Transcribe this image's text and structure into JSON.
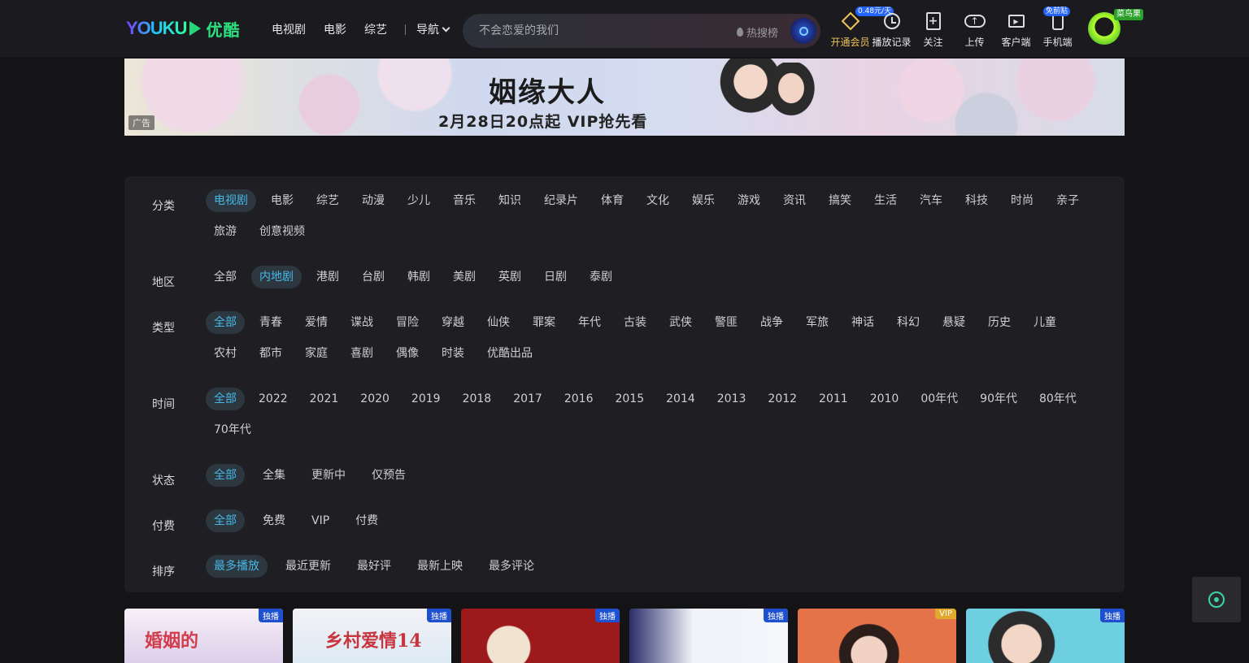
{
  "header": {
    "logo_text": "YOUKU",
    "logo_cn": "优酷",
    "nav": [
      "电视剧",
      "电影",
      "综艺"
    ],
    "guide_label": "导航",
    "search": {
      "placeholder": "不会恋爱的我们",
      "hot_label": "热搜榜"
    },
    "tools": [
      {
        "label": "开通会员",
        "icon": "diamond-icon",
        "tag": "0.48元/天"
      },
      {
        "label": "播放记录",
        "icon": "clock-icon"
      },
      {
        "label": "关注",
        "icon": "bookmark-plus-icon"
      },
      {
        "label": "上传",
        "icon": "upload-cloud-icon"
      },
      {
        "label": "客户端",
        "icon": "tv-play-icon"
      },
      {
        "label": "手机端",
        "icon": "phone-icon",
        "tag": "免前贴"
      }
    ],
    "avatar_badge": "菜鸟果"
  },
  "banner": {
    "title": "姻缘大人",
    "subtitle": "2月28日20点起 VIP抢先看",
    "ad_label": "广告"
  },
  "filters": [
    {
      "label": "分类",
      "active": 0,
      "items": [
        "电视剧",
        "电影",
        "综艺",
        "动漫",
        "少儿",
        "音乐",
        "知识",
        "纪录片",
        "体育",
        "文化",
        "娱乐",
        "游戏",
        "资讯",
        "搞笑",
        "生活",
        "汽车",
        "科技",
        "时尚",
        "亲子",
        "旅游",
        "创意视频"
      ]
    },
    {
      "label": "地区",
      "active": 1,
      "items": [
        "全部",
        "内地剧",
        "港剧",
        "台剧",
        "韩剧",
        "美剧",
        "英剧",
        "日剧",
        "泰剧"
      ]
    },
    {
      "label": "类型",
      "active": 0,
      "items": [
        "全部",
        "青春",
        "爱情",
        "谍战",
        "冒险",
        "穿越",
        "仙侠",
        "罪案",
        "年代",
        "古装",
        "武侠",
        "警匪",
        "战争",
        "军旅",
        "神话",
        "科幻",
        "悬疑",
        "历史",
        "儿童",
        "农村",
        "都市",
        "家庭",
        "喜剧",
        "偶像",
        "时装",
        "优酷出品"
      ]
    },
    {
      "label": "时间",
      "active": 0,
      "items": [
        "全部",
        "2022",
        "2021",
        "2020",
        "2019",
        "2018",
        "2017",
        "2016",
        "2015",
        "2014",
        "2013",
        "2012",
        "2011",
        "2010",
        "00年代",
        "90年代",
        "80年代",
        "70年代"
      ]
    },
    {
      "label": "状态",
      "active": 0,
      "items": [
        "全部",
        "全集",
        "更新中",
        "仅预告"
      ]
    },
    {
      "label": "付费",
      "active": 0,
      "items": [
        "全部",
        "免费",
        "VIP",
        "付费"
      ]
    },
    {
      "label": "排序",
      "active": 0,
      "items": [
        "最多播放",
        "最近更新",
        "最好评",
        "最新上映",
        "最多评论"
      ]
    }
  ],
  "cards": [
    {
      "badge": "独播",
      "title": "婚姻的"
    },
    {
      "badge": "独播",
      "title": "乡村爱情14"
    },
    {
      "badge": "独播",
      "title": ""
    },
    {
      "badge": "独播",
      "title": ""
    },
    {
      "badge": "VIP",
      "title": ""
    },
    {
      "badge": "独播",
      "title": ""
    }
  ],
  "colors": {
    "accent": "#47b7e6",
    "active_chip_bg": "#2d3740",
    "vip_gold": "#f0c35a",
    "brand_green": "#2ee07f"
  }
}
